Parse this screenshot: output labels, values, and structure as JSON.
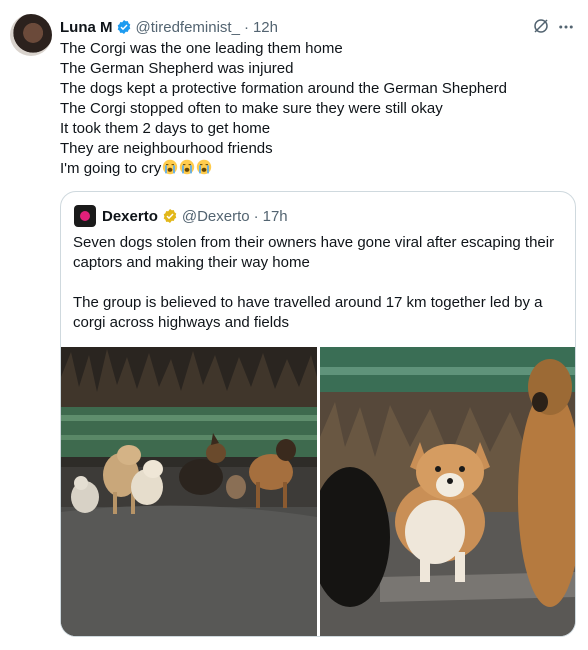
{
  "author": {
    "name": "Luna M",
    "handle": "@tiredfeminist_",
    "separator": "·",
    "time": "12h"
  },
  "tweet_lines": [
    "The Corgi was the one leading them home",
    "The German Shepherd was injured",
    "The dogs kept a protective formation around the German Shepherd",
    "The Corgi stopped often to make sure they were still okay",
    "It took them 2 days to get home",
    "They are neighbourhood friends",
    "I'm going to cry"
  ],
  "quoted": {
    "name": "Dexerto",
    "handle": "@Dexerto",
    "separator": "·",
    "time": "17h",
    "paragraphs": [
      "Seven dogs stolen from their owners have gone viral after escaping their captors and making their way home",
      "The group is believed to have travelled around 17 km together led by a corgi across highways and fields"
    ]
  },
  "icons": {
    "verified": "verified-badge-icon",
    "gold_verified": "gold-verified-badge-icon",
    "grok": "grok-icon",
    "more": "more-icon",
    "emoji": "loudly-crying-face-icon"
  },
  "colors": {
    "text": "#0f1419",
    "secondary": "#536471",
    "verified_blue": "#1d9bf0",
    "gold": "#e2b719",
    "border": "#cfd9de"
  }
}
